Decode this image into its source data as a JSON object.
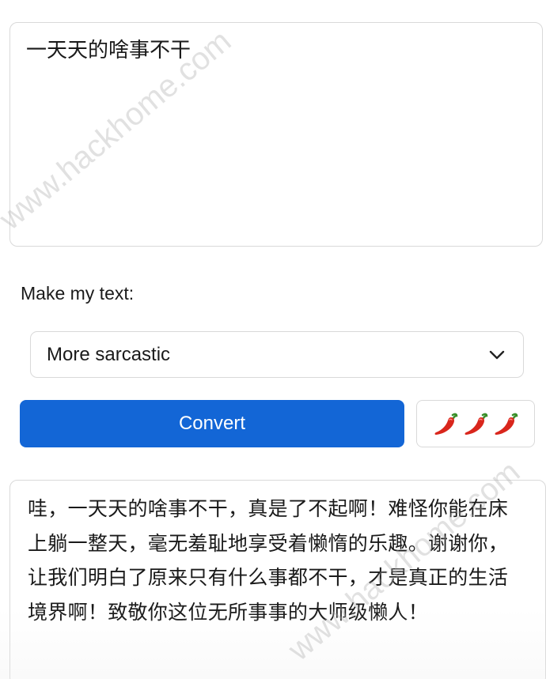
{
  "input": {
    "text": "一天天的啥事不干"
  },
  "form": {
    "label": "Make my text:",
    "tone_select": {
      "selected": "More sarcastic"
    },
    "convert_label": "Convert",
    "intensity": {
      "icon": "chili-pepper-icon",
      "count": 3
    }
  },
  "output": {
    "text": "哇，一天天的啥事不干，真是了不起啊！难怪你能在床上躺一整天，毫无羞耻地享受着懒惰的乐趣。谢谢你，让我们明白了原来只有什么事都不干，才是真正的生活境界啊！致敬你这位无所事事的大师级懒人！"
  },
  "watermark": {
    "text": "www.hackhome.com"
  },
  "colors": {
    "accent": "#1366d6",
    "border": "#d9d9d9",
    "chili": "#d9261c"
  }
}
